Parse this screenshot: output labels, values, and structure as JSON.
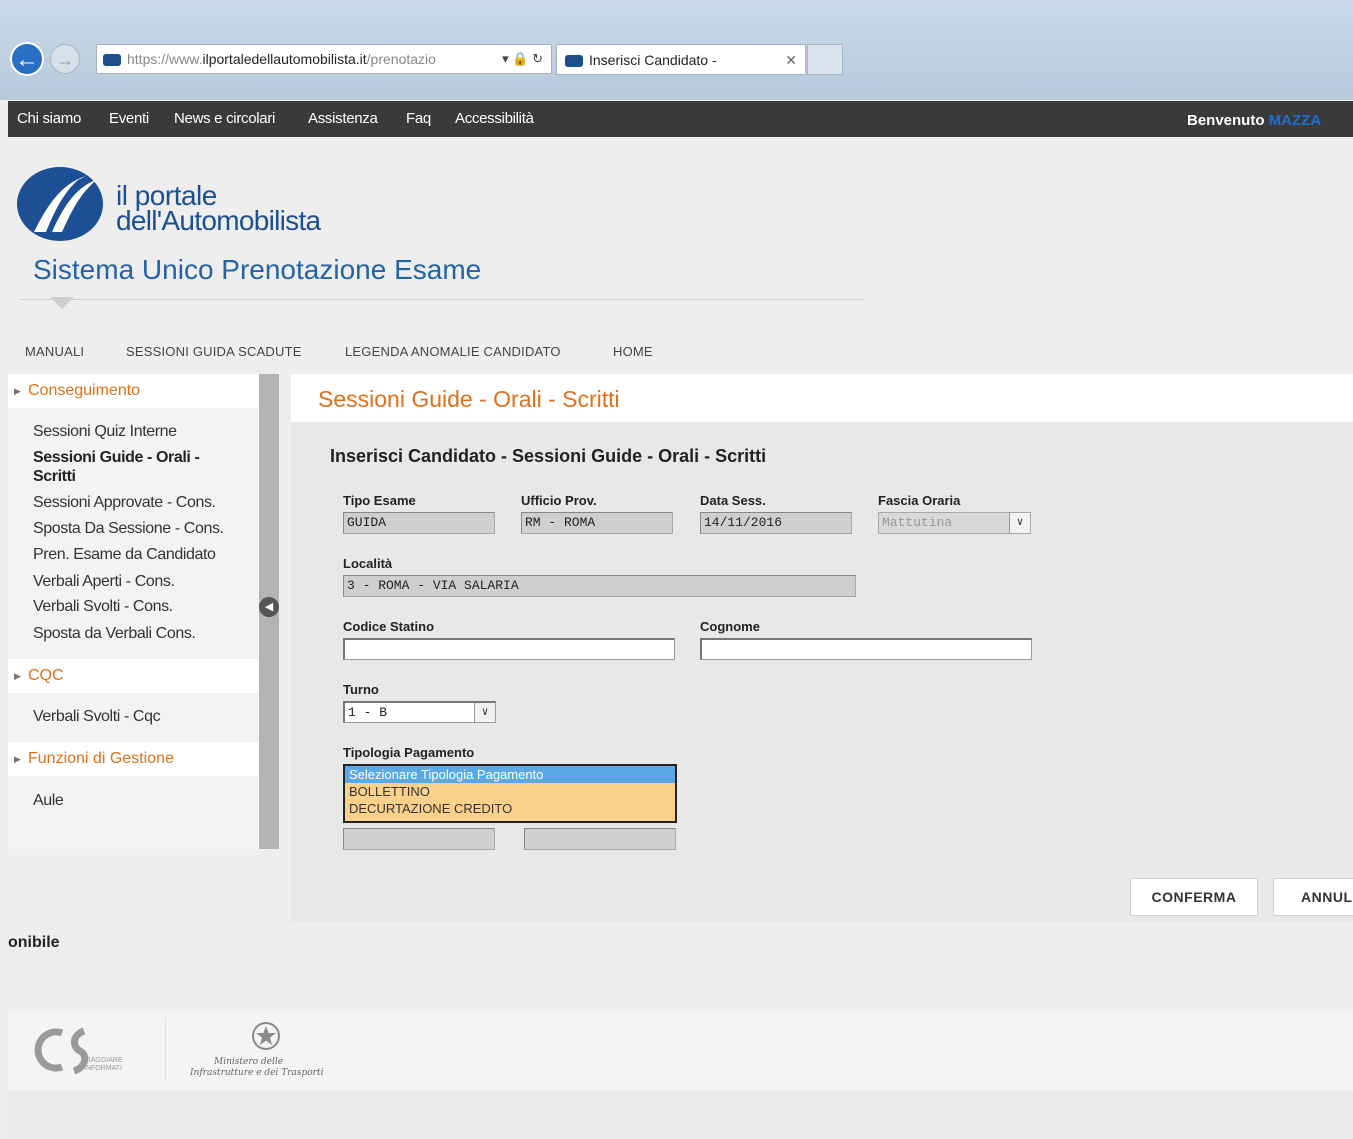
{
  "browser": {
    "url_prefix": "https://www.",
    "url_domain": "ilportaledellautomobilista.it",
    "url_path": "/prenotazio",
    "tab_title": "Inserisci Candidato -"
  },
  "topnav": {
    "items": [
      "Chi siamo",
      "Eventi",
      "News e circolari",
      "Assistenza",
      "Faq",
      "Accessibilità"
    ],
    "welcome_label": "Benvenuto",
    "welcome_user": "MAZZA"
  },
  "header": {
    "brand_line1": "il portale",
    "brand_line2": "dell'Automobilista",
    "system_title": "Sistema Unico Prenotazione Esame"
  },
  "subnav": {
    "items": [
      "MANUALI",
      "SESSIONI GUIDA SCADUTE",
      "LEGENDA ANOMALIE CANDIDATO",
      "HOME"
    ]
  },
  "sidebar": {
    "sections": [
      {
        "label": "Conseguimento",
        "items": [
          "Sessioni Quiz Interne",
          "Sessioni Guide - Orali - Scritti",
          "Sessioni Approvate - Cons.",
          "Sposta Da Sessione - Cons.",
          "Pren. Esame da Candidato",
          "Verbali Aperti - Cons.",
          "Verbali Svolti - Cons.",
          "Sposta da Verbali Cons."
        ]
      },
      {
        "label": "CQC",
        "items": [
          "Verbali Svolti - Cqc"
        ]
      },
      {
        "label": "Funzioni di Gestione",
        "items": [
          "Aule"
        ]
      }
    ]
  },
  "main": {
    "title": "Sessioni Guide - Orali - Scritti",
    "form_title": "Inserisci Candidato - Sessioni Guide - Orali - Scritti",
    "fields": {
      "tipo_esame": {
        "label": "Tipo Esame",
        "value": "GUIDA"
      },
      "ufficio": {
        "label": "Ufficio Prov.",
        "value": "RM - ROMA"
      },
      "data_sess": {
        "label": "Data Sess.",
        "value": "14/11/2016"
      },
      "fascia": {
        "label": "Fascia Oraria",
        "value": "Mattutina"
      },
      "localita": {
        "label": "Località",
        "value": "3 - ROMA - VIA SALARIA"
      },
      "codice_statino": {
        "label": "Codice Statino",
        "value": ""
      },
      "cognome": {
        "label": "Cognome",
        "value": ""
      },
      "turno": {
        "label": "Turno",
        "value": "1 - B"
      },
      "tipologia": {
        "label": "Tipologia Pagamento",
        "options": [
          "Selezionare Tipologia Pagamento",
          "BOLLETTINO",
          "DECURTAZIONE CREDITO"
        ],
        "selected": "Selezionare Tipologia Pagamento"
      }
    },
    "buttons": {
      "confirm": "CONFERMA",
      "cancel": "ANNUL"
    }
  },
  "footer": {
    "availability_text": "onibile",
    "cs_logo_text_1": "VIAGGIARE",
    "cs_logo_text_2": "INFORMATI",
    "ministry_line1": "Ministero delle",
    "ministry_line2": "Infrastrutture e dei Trasporti"
  },
  "colors": {
    "accent_orange": "#e0701a",
    "brand_blue": "#1c4f93",
    "nav_dark": "#3a3a3a",
    "listbox_bg": "#fbd08a",
    "listbox_selected": "#5aa9e6"
  },
  "icons": [
    "back-arrow-icon",
    "forward-arrow-icon",
    "site-favicon-icon",
    "lock-icon",
    "refresh-icon",
    "close-icon",
    "collapse-sidebar-icon",
    "chevron-down-icon"
  ]
}
